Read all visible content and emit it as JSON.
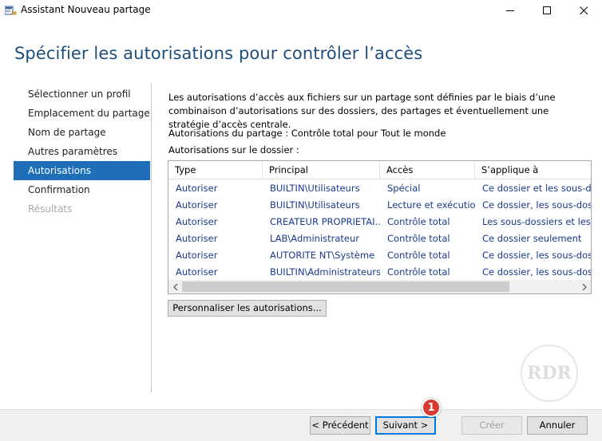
{
  "window": {
    "title": "Assistant Nouveau partage"
  },
  "heading": "Spécifier les autorisations pour contrôler l’accès",
  "nav": {
    "items": [
      {
        "label": "Sélectionner un profil",
        "state": "normal"
      },
      {
        "label": "Emplacement du partage",
        "state": "normal"
      },
      {
        "label": "Nom de partage",
        "state": "normal"
      },
      {
        "label": "Autres paramètres",
        "state": "normal"
      },
      {
        "label": "Autorisations",
        "state": "active"
      },
      {
        "label": "Confirmation",
        "state": "normal"
      },
      {
        "label": "Résultats",
        "state": "disabled"
      }
    ]
  },
  "content": {
    "description": "Les autorisations d’accès aux fichiers sur un partage sont définies par le biais d’une combinaison d’autorisations sur des dossiers, des partages et éventuellement une stratégie d’accès centrale.",
    "share_permissions": "Autorisations du partage : Contrôle total pour Tout le monde",
    "folder_permissions_label": "Autorisations sur le dossier :"
  },
  "table": {
    "columns": [
      "Type",
      "Principal",
      "Accès",
      "S’applique à"
    ],
    "rows": [
      [
        "Autoriser",
        "BUILTIN\\Utilisateurs",
        "Spécial",
        "Ce dossier et les sous-dossiers"
      ],
      [
        "Autoriser",
        "BUILTIN\\Utilisateurs",
        "Lecture et exécution",
        "Ce dossier, les sous-dossiers"
      ],
      [
        "Autoriser",
        "CREATEUR PROPRIETAI...",
        "Contrôle total",
        "Les sous-dossiers et les fichiers"
      ],
      [
        "Autoriser",
        "LAB\\Administrateur",
        "Contrôle total",
        "Ce dossier seulement"
      ],
      [
        "Autoriser",
        "AUTORITE NT\\Système",
        "Contrôle total",
        "Ce dossier, les sous-dossiers"
      ],
      [
        "Autoriser",
        "BUILTIN\\Administrateurs",
        "Contrôle total",
        "Ce dossier, les sous-dossiers"
      ]
    ],
    "hscroll_position": 0.0
  },
  "buttons": {
    "customize": "Personnaliser les autorisations...",
    "previous": "< Précédent",
    "next": "Suivant >",
    "create": "Créer",
    "cancel": "Annuler"
  },
  "annotation": {
    "badge_number": "1"
  },
  "watermark": {
    "text": "RDR"
  },
  "colors": {
    "heading": "#1e4e79",
    "nav_active_bg": "#1e6fb8",
    "table_text": "#1a3a8a",
    "badge": "#d93a31"
  }
}
